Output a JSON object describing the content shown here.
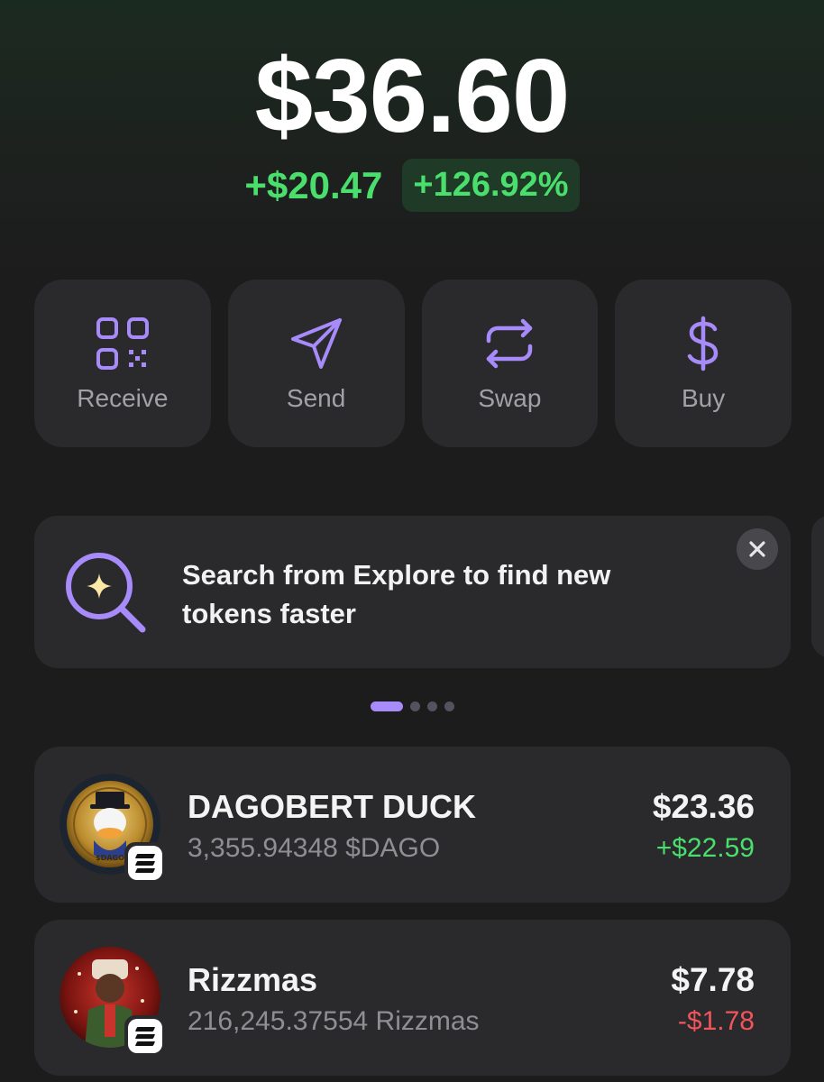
{
  "balance": {
    "total": "$36.60",
    "change_amount": "+$20.47",
    "change_percent": "+126.92%"
  },
  "actions": [
    {
      "label": "Receive",
      "icon": "qr-code-icon"
    },
    {
      "label": "Send",
      "icon": "send-icon"
    },
    {
      "label": "Swap",
      "icon": "swap-icon"
    },
    {
      "label": "Buy",
      "icon": "dollar-icon"
    }
  ],
  "banner": {
    "text": "Search from Explore to find new tokens faster",
    "icon": "search-sparkle-icon",
    "close_icon": "close-icon"
  },
  "carousel": {
    "total_pages": 4,
    "active_page": 1
  },
  "tokens": [
    {
      "name": "DAGOBERT DUCK",
      "amount": "3,355.94348 $DAGO",
      "value": "$23.36",
      "change": "+$22.59",
      "change_direction": "positive",
      "chain_icon": "solana-icon",
      "logo_text": "$DAGO"
    },
    {
      "name": "Rizzmas",
      "amount": "216,245.37554 Rizzmas",
      "value": "$7.78",
      "change": "-$1.78",
      "change_direction": "negative",
      "chain_icon": "solana-icon"
    }
  ],
  "colors": {
    "accent": "#a78bfa",
    "positive": "#4ade6d",
    "negative": "#f2545b",
    "card": "#2a2a2d",
    "background": "#1c1c1c"
  }
}
